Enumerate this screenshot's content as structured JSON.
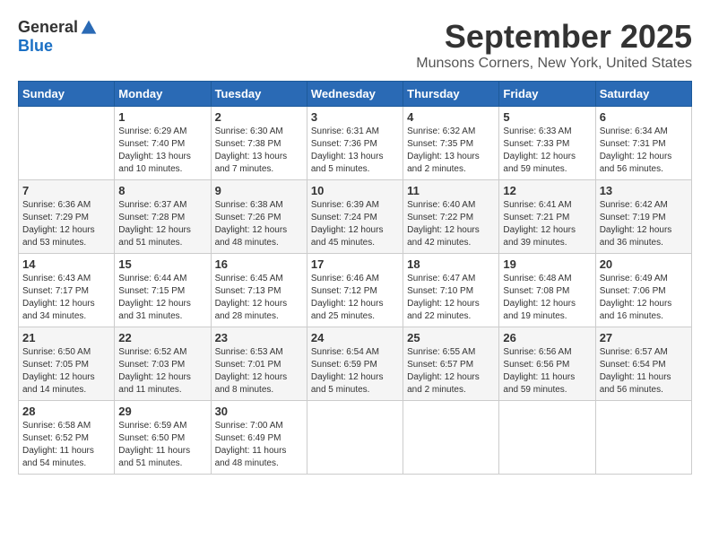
{
  "logo": {
    "general": "General",
    "blue": "Blue"
  },
  "title": "September 2025",
  "location": "Munsons Corners, New York, United States",
  "weekdays": [
    "Sunday",
    "Monday",
    "Tuesday",
    "Wednesday",
    "Thursday",
    "Friday",
    "Saturday"
  ],
  "weeks": [
    [
      {
        "day": "",
        "sunrise": "",
        "sunset": "",
        "daylight": ""
      },
      {
        "day": "1",
        "sunrise": "Sunrise: 6:29 AM",
        "sunset": "Sunset: 7:40 PM",
        "daylight": "Daylight: 13 hours and 10 minutes."
      },
      {
        "day": "2",
        "sunrise": "Sunrise: 6:30 AM",
        "sunset": "Sunset: 7:38 PM",
        "daylight": "Daylight: 13 hours and 7 minutes."
      },
      {
        "day": "3",
        "sunrise": "Sunrise: 6:31 AM",
        "sunset": "Sunset: 7:36 PM",
        "daylight": "Daylight: 13 hours and 5 minutes."
      },
      {
        "day": "4",
        "sunrise": "Sunrise: 6:32 AM",
        "sunset": "Sunset: 7:35 PM",
        "daylight": "Daylight: 13 hours and 2 minutes."
      },
      {
        "day": "5",
        "sunrise": "Sunrise: 6:33 AM",
        "sunset": "Sunset: 7:33 PM",
        "daylight": "Daylight: 12 hours and 59 minutes."
      },
      {
        "day": "6",
        "sunrise": "Sunrise: 6:34 AM",
        "sunset": "Sunset: 7:31 PM",
        "daylight": "Daylight: 12 hours and 56 minutes."
      }
    ],
    [
      {
        "day": "7",
        "sunrise": "Sunrise: 6:36 AM",
        "sunset": "Sunset: 7:29 PM",
        "daylight": "Daylight: 12 hours and 53 minutes."
      },
      {
        "day": "8",
        "sunrise": "Sunrise: 6:37 AM",
        "sunset": "Sunset: 7:28 PM",
        "daylight": "Daylight: 12 hours and 51 minutes."
      },
      {
        "day": "9",
        "sunrise": "Sunrise: 6:38 AM",
        "sunset": "Sunset: 7:26 PM",
        "daylight": "Daylight: 12 hours and 48 minutes."
      },
      {
        "day": "10",
        "sunrise": "Sunrise: 6:39 AM",
        "sunset": "Sunset: 7:24 PM",
        "daylight": "Daylight: 12 hours and 45 minutes."
      },
      {
        "day": "11",
        "sunrise": "Sunrise: 6:40 AM",
        "sunset": "Sunset: 7:22 PM",
        "daylight": "Daylight: 12 hours and 42 minutes."
      },
      {
        "day": "12",
        "sunrise": "Sunrise: 6:41 AM",
        "sunset": "Sunset: 7:21 PM",
        "daylight": "Daylight: 12 hours and 39 minutes."
      },
      {
        "day": "13",
        "sunrise": "Sunrise: 6:42 AM",
        "sunset": "Sunset: 7:19 PM",
        "daylight": "Daylight: 12 hours and 36 minutes."
      }
    ],
    [
      {
        "day": "14",
        "sunrise": "Sunrise: 6:43 AM",
        "sunset": "Sunset: 7:17 PM",
        "daylight": "Daylight: 12 hours and 34 minutes."
      },
      {
        "day": "15",
        "sunrise": "Sunrise: 6:44 AM",
        "sunset": "Sunset: 7:15 PM",
        "daylight": "Daylight: 12 hours and 31 minutes."
      },
      {
        "day": "16",
        "sunrise": "Sunrise: 6:45 AM",
        "sunset": "Sunset: 7:13 PM",
        "daylight": "Daylight: 12 hours and 28 minutes."
      },
      {
        "day": "17",
        "sunrise": "Sunrise: 6:46 AM",
        "sunset": "Sunset: 7:12 PM",
        "daylight": "Daylight: 12 hours and 25 minutes."
      },
      {
        "day": "18",
        "sunrise": "Sunrise: 6:47 AM",
        "sunset": "Sunset: 7:10 PM",
        "daylight": "Daylight: 12 hours and 22 minutes."
      },
      {
        "day": "19",
        "sunrise": "Sunrise: 6:48 AM",
        "sunset": "Sunset: 7:08 PM",
        "daylight": "Daylight: 12 hours and 19 minutes."
      },
      {
        "day": "20",
        "sunrise": "Sunrise: 6:49 AM",
        "sunset": "Sunset: 7:06 PM",
        "daylight": "Daylight: 12 hours and 16 minutes."
      }
    ],
    [
      {
        "day": "21",
        "sunrise": "Sunrise: 6:50 AM",
        "sunset": "Sunset: 7:05 PM",
        "daylight": "Daylight: 12 hours and 14 minutes."
      },
      {
        "day": "22",
        "sunrise": "Sunrise: 6:52 AM",
        "sunset": "Sunset: 7:03 PM",
        "daylight": "Daylight: 12 hours and 11 minutes."
      },
      {
        "day": "23",
        "sunrise": "Sunrise: 6:53 AM",
        "sunset": "Sunset: 7:01 PM",
        "daylight": "Daylight: 12 hours and 8 minutes."
      },
      {
        "day": "24",
        "sunrise": "Sunrise: 6:54 AM",
        "sunset": "Sunset: 6:59 PM",
        "daylight": "Daylight: 12 hours and 5 minutes."
      },
      {
        "day": "25",
        "sunrise": "Sunrise: 6:55 AM",
        "sunset": "Sunset: 6:57 PM",
        "daylight": "Daylight: 12 hours and 2 minutes."
      },
      {
        "day": "26",
        "sunrise": "Sunrise: 6:56 AM",
        "sunset": "Sunset: 6:56 PM",
        "daylight": "Daylight: 11 hours and 59 minutes."
      },
      {
        "day": "27",
        "sunrise": "Sunrise: 6:57 AM",
        "sunset": "Sunset: 6:54 PM",
        "daylight": "Daylight: 11 hours and 56 minutes."
      }
    ],
    [
      {
        "day": "28",
        "sunrise": "Sunrise: 6:58 AM",
        "sunset": "Sunset: 6:52 PM",
        "daylight": "Daylight: 11 hours and 54 minutes."
      },
      {
        "day": "29",
        "sunrise": "Sunrise: 6:59 AM",
        "sunset": "Sunset: 6:50 PM",
        "daylight": "Daylight: 11 hours and 51 minutes."
      },
      {
        "day": "30",
        "sunrise": "Sunrise: 7:00 AM",
        "sunset": "Sunset: 6:49 PM",
        "daylight": "Daylight: 11 hours and 48 minutes."
      },
      {
        "day": "",
        "sunrise": "",
        "sunset": "",
        "daylight": ""
      },
      {
        "day": "",
        "sunrise": "",
        "sunset": "",
        "daylight": ""
      },
      {
        "day": "",
        "sunrise": "",
        "sunset": "",
        "daylight": ""
      },
      {
        "day": "",
        "sunrise": "",
        "sunset": "",
        "daylight": ""
      }
    ]
  ]
}
